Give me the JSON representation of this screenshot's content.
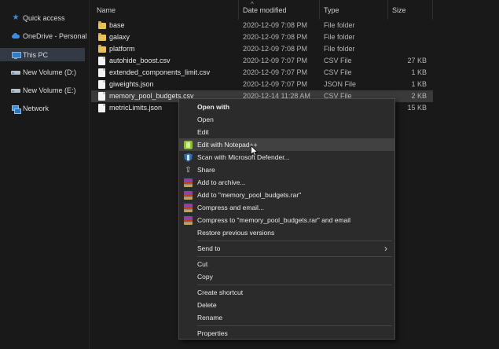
{
  "nav": {
    "items": [
      {
        "label": "Quick access",
        "icon": "star-icon"
      },
      {
        "label": "OneDrive - Personal",
        "icon": "cloud-icon"
      },
      {
        "label": "This PC",
        "icon": "computer-icon",
        "selected": true
      },
      {
        "label": "New Volume (D:)",
        "icon": "drive-icon"
      },
      {
        "label": "New Volume (E:)",
        "icon": "drive-icon"
      },
      {
        "label": "Network",
        "icon": "network-icon"
      }
    ]
  },
  "columns": {
    "name": "Name",
    "date": "Date modified",
    "type": "Type",
    "size": "Size"
  },
  "files": [
    {
      "name": "base",
      "date": "2020-12-09 7:08 PM",
      "type": "File folder",
      "size": "",
      "icon": "folder-icon"
    },
    {
      "name": "galaxy",
      "date": "2020-12-09 7:08 PM",
      "type": "File folder",
      "size": "",
      "icon": "folder-icon"
    },
    {
      "name": "platform",
      "date": "2020-12-09 7:08 PM",
      "type": "File folder",
      "size": "",
      "icon": "folder-icon"
    },
    {
      "name": "autohide_boost.csv",
      "date": "2020-12-09 7:07 PM",
      "type": "CSV File",
      "size": "27 KB",
      "icon": "document-icon"
    },
    {
      "name": "extended_components_limit.csv",
      "date": "2020-12-09 7:07 PM",
      "type": "CSV File",
      "size": "1 KB",
      "icon": "document-icon"
    },
    {
      "name": "giweights.json",
      "date": "2020-12-09 7:07 PM",
      "type": "JSON File",
      "size": "1 KB",
      "icon": "document-icon"
    },
    {
      "name": "memory_pool_budgets.csv",
      "date": "2020-12-14 11:28 AM",
      "type": "CSV File",
      "size": "2 KB",
      "icon": "document-icon",
      "selected": true
    },
    {
      "name": "metricLimits.json",
      "date": "",
      "type": "",
      "size": "15 KB",
      "icon": "document-icon"
    }
  ],
  "context_menu": {
    "items": [
      "Open with",
      "Open",
      "Edit",
      "Edit with Notepad++",
      "Scan with Microsoft Defender...",
      "Share",
      "Add to archive...",
      "Add to \"memory_pool_budgets.rar\"",
      "Compress and email...",
      "Compress to \"memory_pool_budgets.rar\" and email",
      "Restore previous versions",
      "Send to",
      "Cut",
      "Copy",
      "Create shortcut",
      "Delete",
      "Rename",
      "Properties"
    ],
    "hovered": "Edit with Notepad++"
  }
}
